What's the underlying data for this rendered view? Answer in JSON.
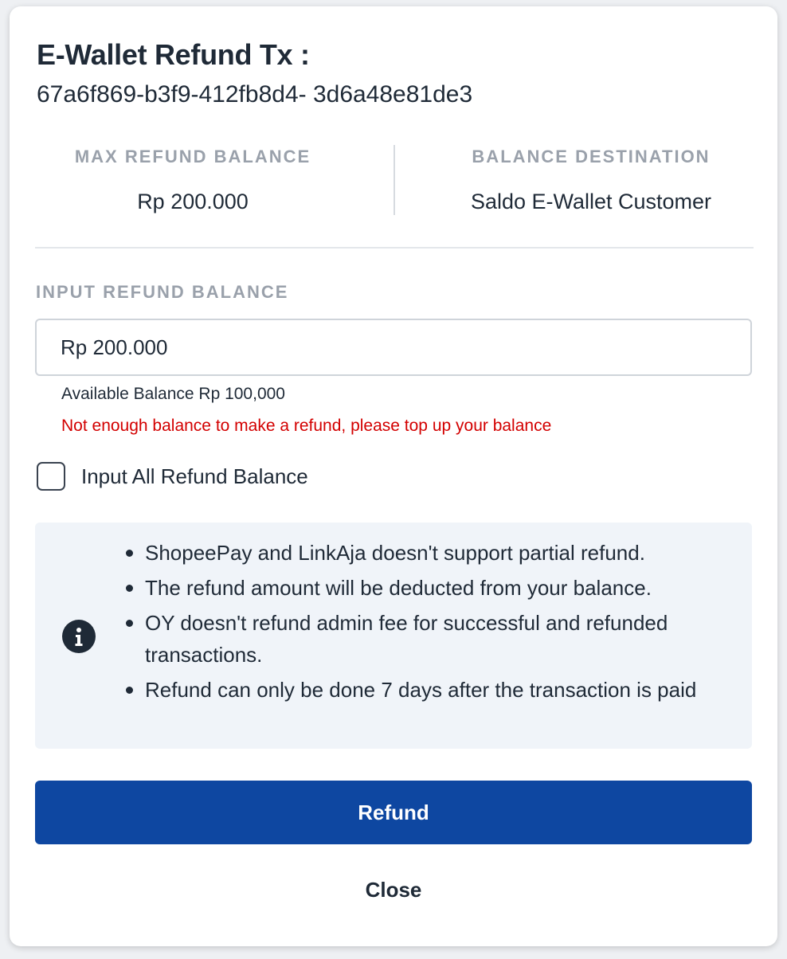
{
  "modal": {
    "title": "E-Wallet Refund Tx :",
    "transaction_id": "67a6f869-b3f9-412fb8d4- 3d6a48e81de3"
  },
  "summary": {
    "max_refund": {
      "label": "MAX REFUND BALANCE",
      "value": "Rp 200.000"
    },
    "destination": {
      "label": "BALANCE DESTINATION",
      "value": "Saldo E-Wallet Customer"
    }
  },
  "refund_input": {
    "label": "INPUT REFUND BALANCE",
    "value": "Rp 200.000",
    "available_balance": "Available Balance Rp 100,000",
    "error_message": "Not enough balance to make a refund, please top up your balance"
  },
  "checkbox": {
    "label": "Input All Refund Balance",
    "checked": false
  },
  "info": {
    "icon": "info-icon",
    "items": [
      "ShopeePay and LinkAja doesn't support partial refund.",
      "The refund amount will be deducted from your balance.",
      "OY doesn't refund admin fee for successful and refunded transactions.",
      "Refund can only be done 7 days after the transaction is paid"
    ]
  },
  "actions": {
    "refund_label": "Refund",
    "close_label": "Close"
  },
  "colors": {
    "primary": "#0e47a1",
    "error": "#d30000",
    "muted_label": "#9aa1ab",
    "info_background": "#f0f4f9"
  }
}
